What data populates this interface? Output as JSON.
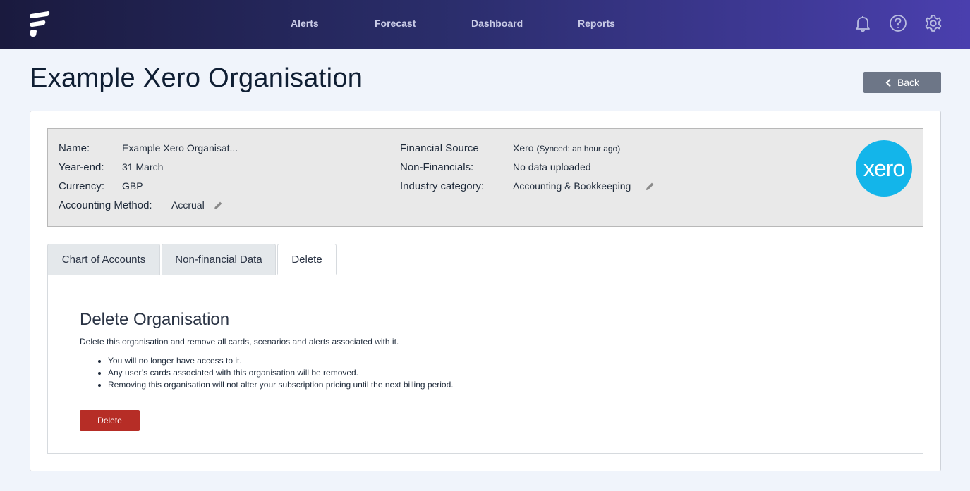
{
  "header": {
    "logo_icon": "brand-logo-icon",
    "nav": [
      {
        "label": "Alerts"
      },
      {
        "label": "Forecast"
      },
      {
        "label": "Dashboard"
      },
      {
        "label": "Reports"
      }
    ],
    "icons": [
      "bell-icon",
      "help-icon",
      "gear-icon"
    ]
  },
  "page": {
    "title": "Example Xero Organisation",
    "back_label": "Back"
  },
  "org": {
    "name_label": "Name:",
    "name_value": "Example Xero Organisat...",
    "yearend_label": "Year-end:",
    "yearend_value": "31 March",
    "currency_label": "Currency:",
    "currency_value": "GBP",
    "method_label": "Accounting Method:",
    "method_value": "Accrual",
    "source_label": "Financial Source",
    "source_value": "Xero",
    "source_sync": "(Synced: an hour ago)",
    "nonfin_label": "Non-Financials:",
    "nonfin_value": "No data uploaded",
    "industry_label": "Industry category:",
    "industry_value": "Accounting & Bookkeeping",
    "logo_text": "xero",
    "logo_color": "#13b5ea"
  },
  "tabs": [
    {
      "label": "Chart of Accounts",
      "active": false
    },
    {
      "label": "Non-financial Data",
      "active": false
    },
    {
      "label": "Delete",
      "active": true
    }
  ],
  "delete_section": {
    "title": "Delete Organisation",
    "description": "Delete this organisation and remove all cards, scenarios and alerts associated with it.",
    "bullets": [
      "You will no longer have access to it.",
      "Any user’s cards associated with this organisation will be removed.",
      "Removing this organisation will not alter your subscription pricing until the next billing period."
    ],
    "button_label": "Delete",
    "button_color": "#b62d26"
  }
}
